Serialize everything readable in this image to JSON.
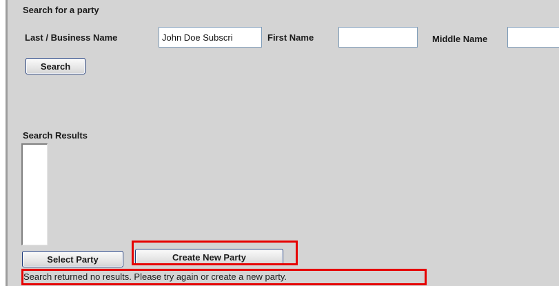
{
  "search_section": {
    "title": "Search for a party",
    "last_name_label": "Last / Business Name",
    "last_name_value": "John Doe Subscri",
    "first_name_label": "First Name",
    "first_name_value": "",
    "middle_name_label": "Middle Name",
    "middle_name_value": "",
    "search_button": "Search"
  },
  "results_section": {
    "title": "Search Results",
    "items": [],
    "select_button": "Select Party",
    "create_button": "Create New Party",
    "status_message": "Search returned no results. Please try again or create a new party."
  },
  "colors": {
    "background": "#d4d4d4",
    "highlight": "#e60000",
    "button_border": "#1d3a7a"
  }
}
